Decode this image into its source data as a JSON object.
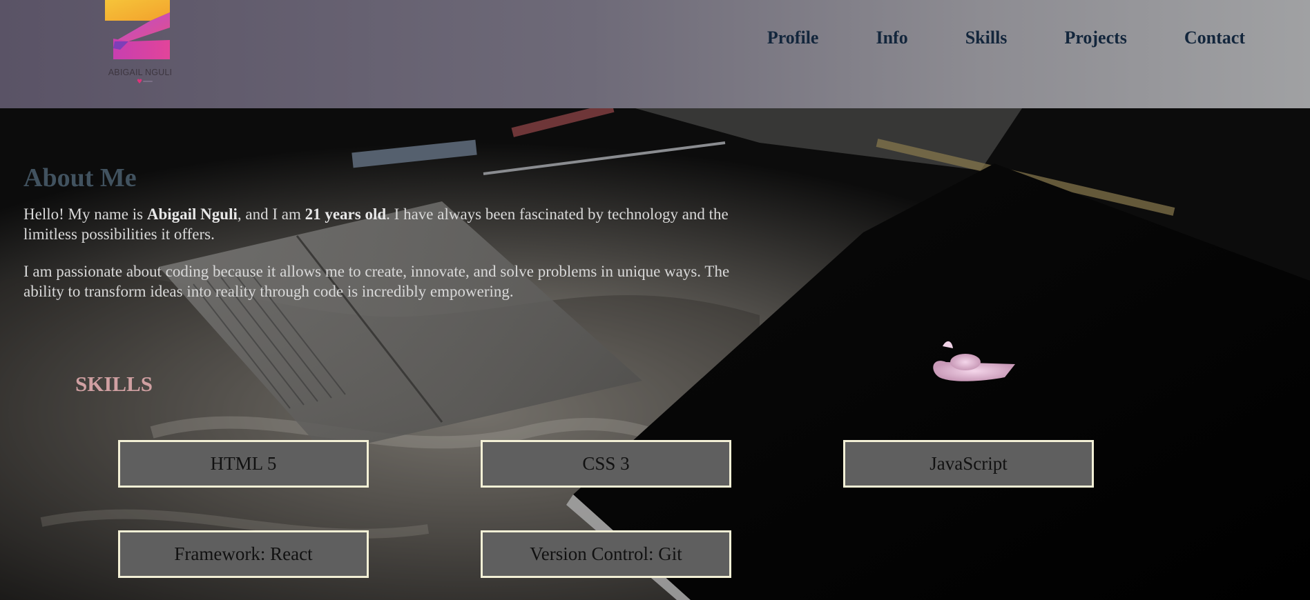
{
  "header": {
    "logo_text": "ABIGAIL NGULI",
    "nav": [
      "Profile",
      "Info",
      "Skills",
      "Projects",
      "Contact"
    ]
  },
  "about": {
    "title": "About Me",
    "p1": {
      "a": "Hello! My name is ",
      "name": "Abigail Nguli",
      "b": ", and I am ",
      "age": "21 years old",
      "c": ". I have always been fascinated by technology and the limitless possibilities it offers."
    },
    "p2": "I am passionate about coding because it allows me to create, innovate, and solve problems in unique ways. The ability to transform ideas into reality through code is incredibly empowering."
  },
  "skills": {
    "title": "SKILLS",
    "items": [
      "HTML 5",
      "CSS 3",
      "JavaScript",
      "Framework: React",
      "Version Control: Git"
    ]
  },
  "colors": {
    "nav_text": "#13263c",
    "about_title": "#41525f",
    "skills_title": "#d0a0a2",
    "skill_box_bg": "#5f5f5f",
    "skill_box_border": "#f3f0d6"
  }
}
